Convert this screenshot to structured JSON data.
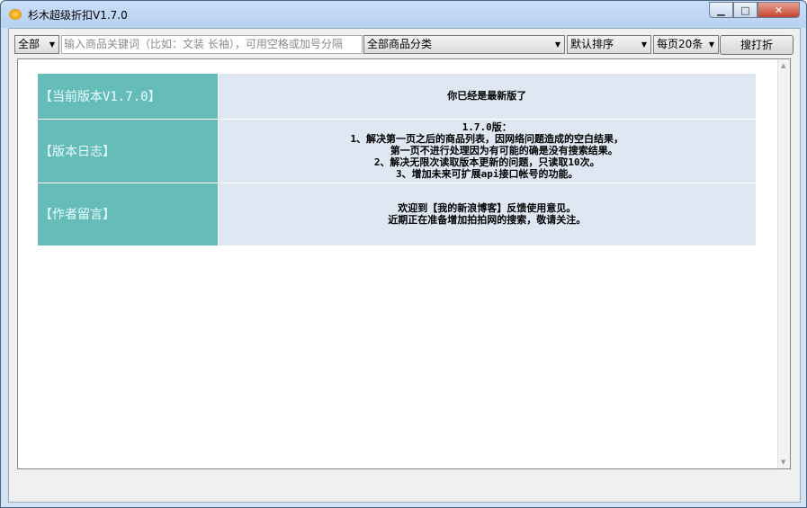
{
  "window": {
    "title": "杉木超级折扣V1.7.0"
  },
  "toolbar": {
    "scope": "全部",
    "search_placeholder": "输入商品关键词（比如：文装 长袖），可用空格或加号分隔",
    "category": "全部商品分类",
    "sort": "默认排序",
    "per_page": "每页20条",
    "search_button": "搜打折"
  },
  "info": {
    "rows": [
      {
        "label": "【当前版本V1.7.0】",
        "lines": [
          "你已经是最新版了"
        ]
      },
      {
        "label": "【版本日志】",
        "lines": [
          "1.7.0版：",
          "1、解决第一页之后的商品列表，因网络问题造成的空白结果，",
          "第一页不进行处理因为有可能的确是没有搜索结果。",
          "2、解决无限次读取版本更新的问题，只读取10次。",
          "3、增加未来可扩展api接口帐号的功能。"
        ]
      },
      {
        "label": "【作者留言】",
        "lines": [
          "欢迎到【我的新浪博客】反馈使用意见。",
          "近期正在准备增加拍拍网的搜索，敬请关注。"
        ]
      }
    ]
  }
}
